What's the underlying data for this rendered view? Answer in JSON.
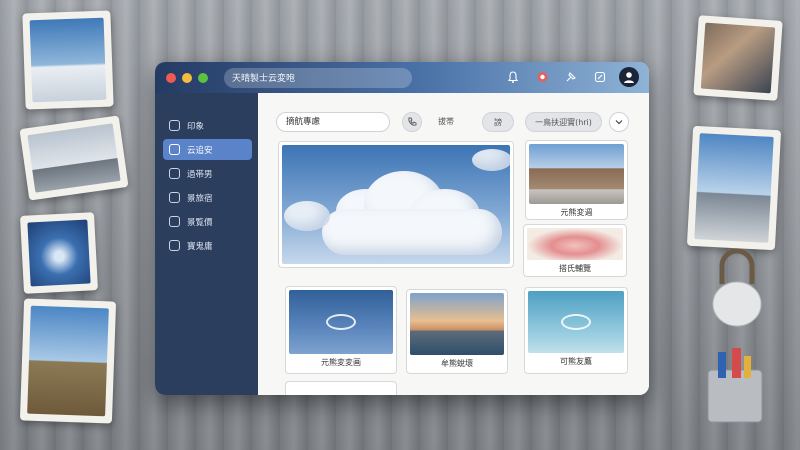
{
  "window": {
    "title": "天晴製士云変咆"
  },
  "header": {
    "icons": [
      "bell-icon",
      "chat-icon",
      "pin-icon",
      "edit-icon",
      "user-avatar-icon"
    ]
  },
  "sidebar": {
    "items": [
      {
        "label": "印象",
        "icon": "home-icon"
      },
      {
        "label": "云追安",
        "icon": "chart-icon",
        "active": true
      },
      {
        "label": "過帯男",
        "icon": "heart-icon"
      },
      {
        "label": "景旅宿",
        "icon": "user-icon"
      },
      {
        "label": "景覧價",
        "icon": "doc-icon"
      },
      {
        "label": "寶鬼庸",
        "icon": "grid-icon"
      }
    ]
  },
  "toolbar": {
    "search_value": "摘航專慮",
    "filter_text": "拔帯",
    "chip_label": "謗",
    "select_value": "一鳥扶迎實(hri)"
  },
  "gallery": {
    "captions": {
      "street": "元熊変週",
      "flower": "搭氏輔覽",
      "blue_cloud": "元熊変変画",
      "sunset": "牟熊蛻壞",
      "teal_sky": "可熊友鷹"
    }
  },
  "colors": {
    "titlebar": "#2c4670",
    "sidebar": "#2b3e5e",
    "active_item": "#5a83c9",
    "background": "#f7f7f5"
  }
}
